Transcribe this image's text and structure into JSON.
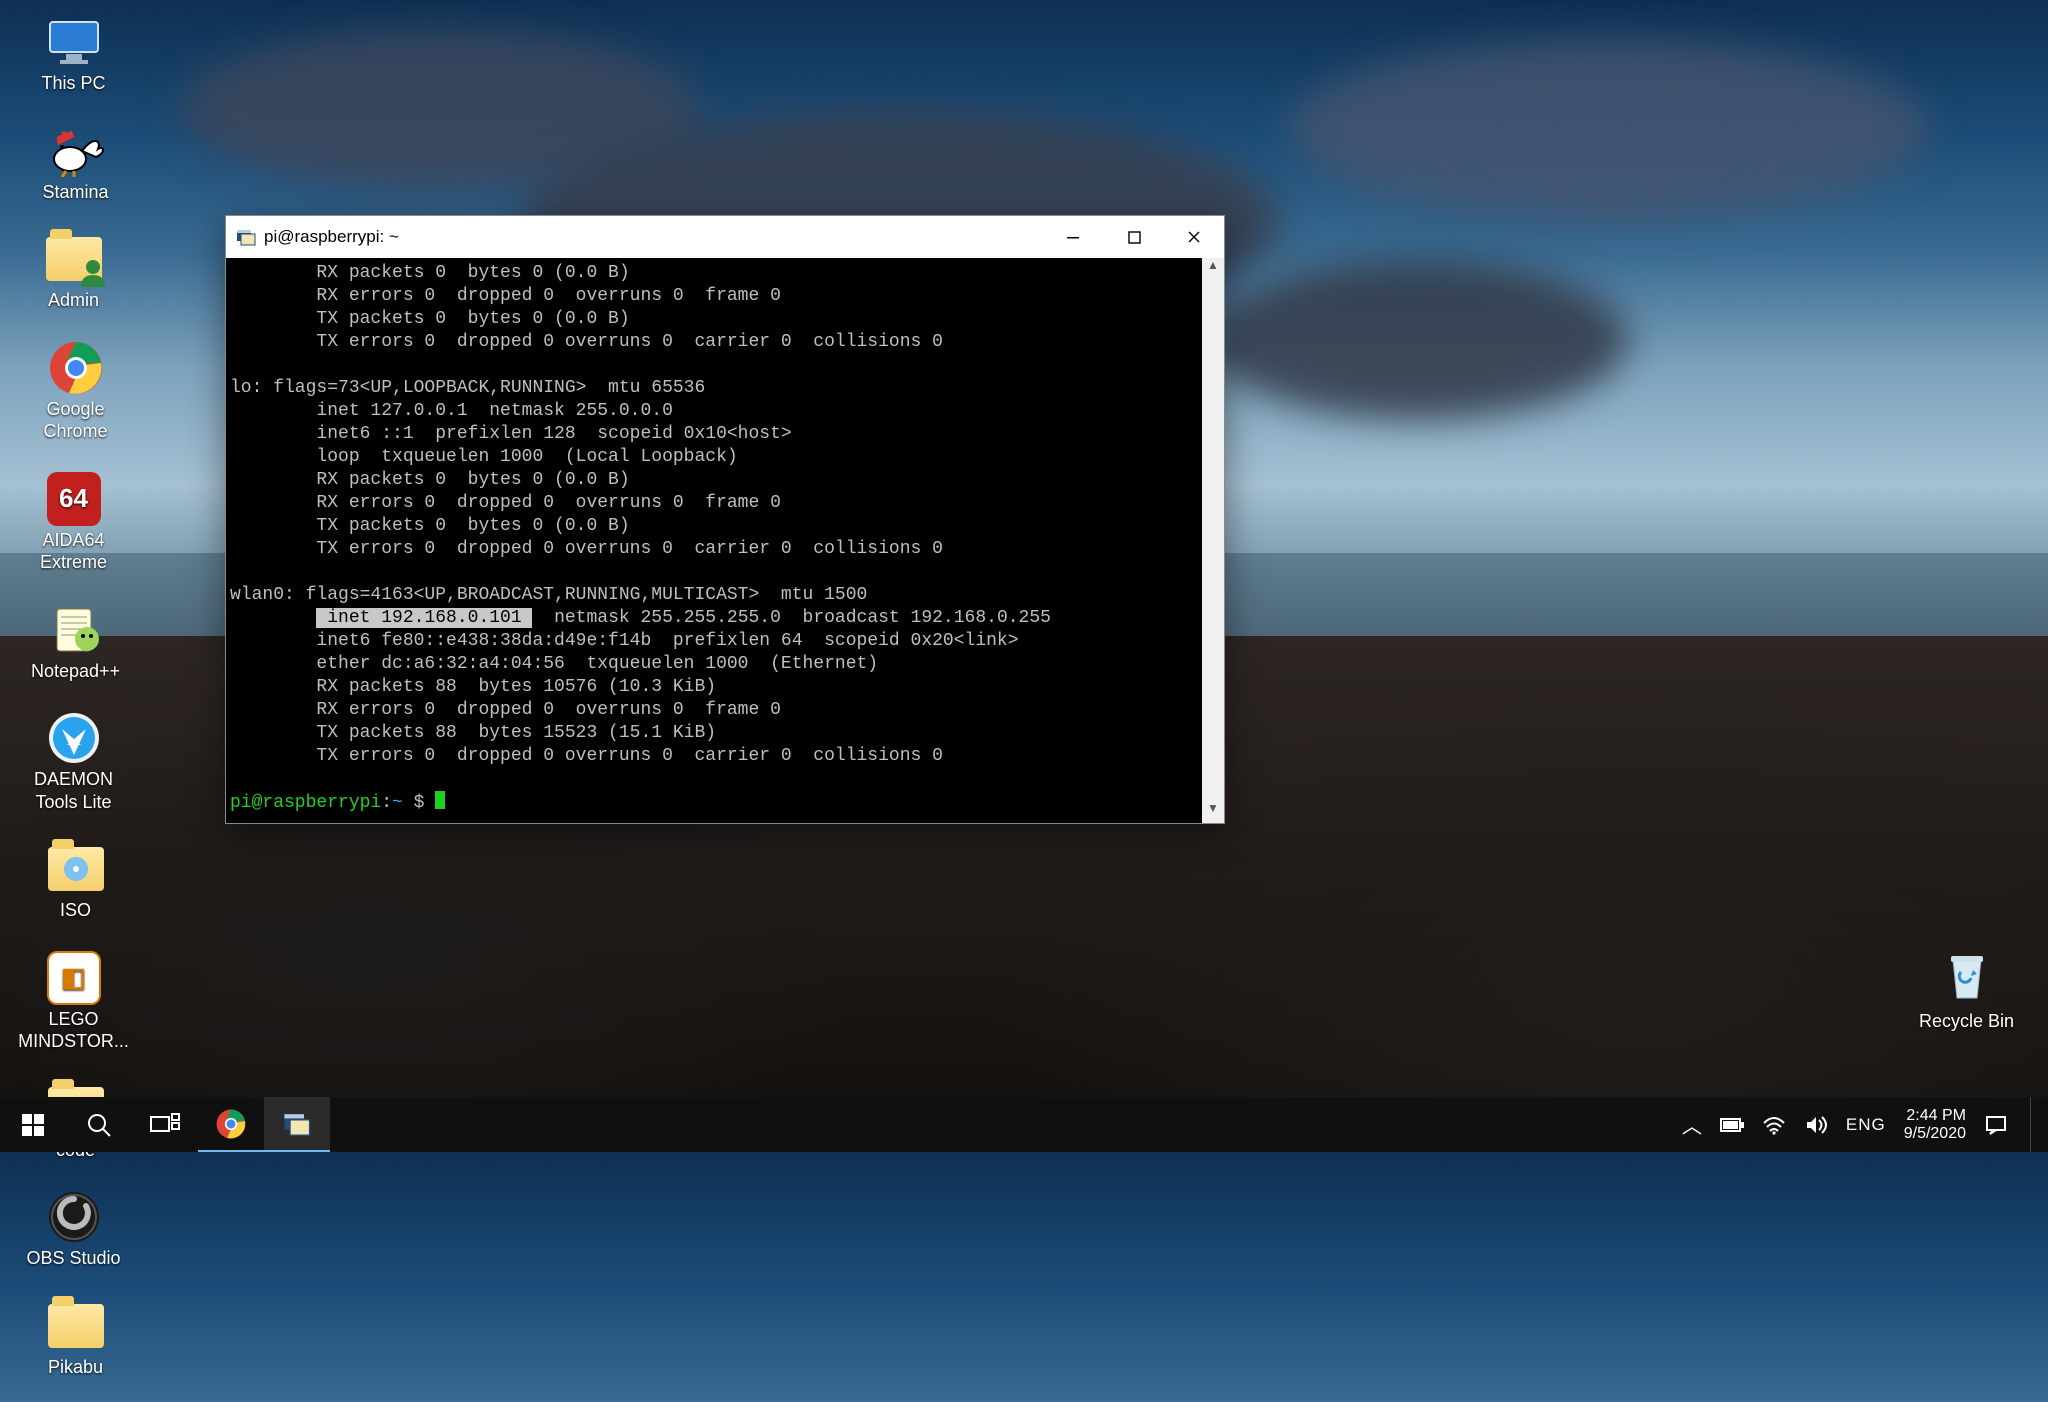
{
  "desktop": {
    "left_icons": [
      {
        "name": "this-pc",
        "label": "This PC",
        "kind": "pc"
      },
      {
        "name": "stamina",
        "label": "Stamina",
        "kind": "stamina"
      },
      {
        "name": "admin",
        "label": "Admin",
        "kind": "folder-user"
      },
      {
        "name": "google-chrome",
        "label": "Google Chrome",
        "kind": "chrome"
      },
      {
        "name": "aida64",
        "label": "AIDA64 Extreme",
        "kind": "aida"
      },
      {
        "name": "notepadpp",
        "label": "Notepad++",
        "kind": "npp"
      },
      {
        "name": "daemon",
        "label": "DAEMON Tools Lite",
        "kind": "daemon"
      },
      {
        "name": "iso",
        "label": "ISO",
        "kind": "folder"
      },
      {
        "name": "lego",
        "label": "LEGO MINDSTOR...",
        "kind": "lego"
      },
      {
        "name": "code",
        "label": "code",
        "kind": "folder"
      },
      {
        "name": "obs",
        "label": "OBS Studio",
        "kind": "obs"
      },
      {
        "name": "pikabu",
        "label": "Pikabu",
        "kind": "folder"
      }
    ],
    "recycle_label": "Recycle Bin"
  },
  "window": {
    "title": "pi@raspberrypi: ~",
    "terminal_lines": [
      "        RX packets 0  bytes 0 (0.0 B)",
      "        RX errors 0  dropped 0  overruns 0  frame 0",
      "        TX packets 0  bytes 0 (0.0 B)",
      "        TX errors 0  dropped 0 overruns 0  carrier 0  collisions 0",
      "",
      "lo: flags=73<UP,LOOPBACK,RUNNING>  mtu 65536",
      "        inet 127.0.0.1  netmask 255.0.0.0",
      "        inet6 ::1  prefixlen 128  scopeid 0x10<host>",
      "        loop  txqueuelen 1000  (Local Loopback)",
      "        RX packets 0  bytes 0 (0.0 B)",
      "        RX errors 0  dropped 0  overruns 0  frame 0",
      "        TX packets 0  bytes 0 (0.0 B)",
      "        TX errors 0  dropped 0 overruns 0  carrier 0  collisions 0",
      "",
      "wlan0: flags=4163<UP,BROADCAST,RUNNING,MULTICAST>  mtu 1500"
    ],
    "highlight_line_prefix": "        ",
    "highlight_text": " inet 192.168.0.101 ",
    "highlight_line_suffix": "  netmask 255.255.255.0  broadcast 192.168.0.255",
    "terminal_lines_after": [
      "        inet6 fe80::e438:38da:d49e:f14b  prefixlen 64  scopeid 0x20<link>",
      "        ether dc:a6:32:a4:04:56  txqueuelen 1000  (Ethernet)",
      "        RX packets 88  bytes 10576 (10.3 KiB)",
      "        RX errors 0  dropped 0  overruns 0  frame 0",
      "        TX packets 88  bytes 15523 (15.1 KiB)",
      "        TX errors 0  dropped 0 overruns 0  carrier 0  collisions 0",
      ""
    ],
    "prompt_user": "pi@raspberrypi",
    "prompt_sep": ":",
    "prompt_path": "~",
    "prompt_dollar": " $ "
  },
  "taskbar": {
    "lang": "ENG",
    "time": "2:44 PM",
    "date": "9/5/2020"
  }
}
